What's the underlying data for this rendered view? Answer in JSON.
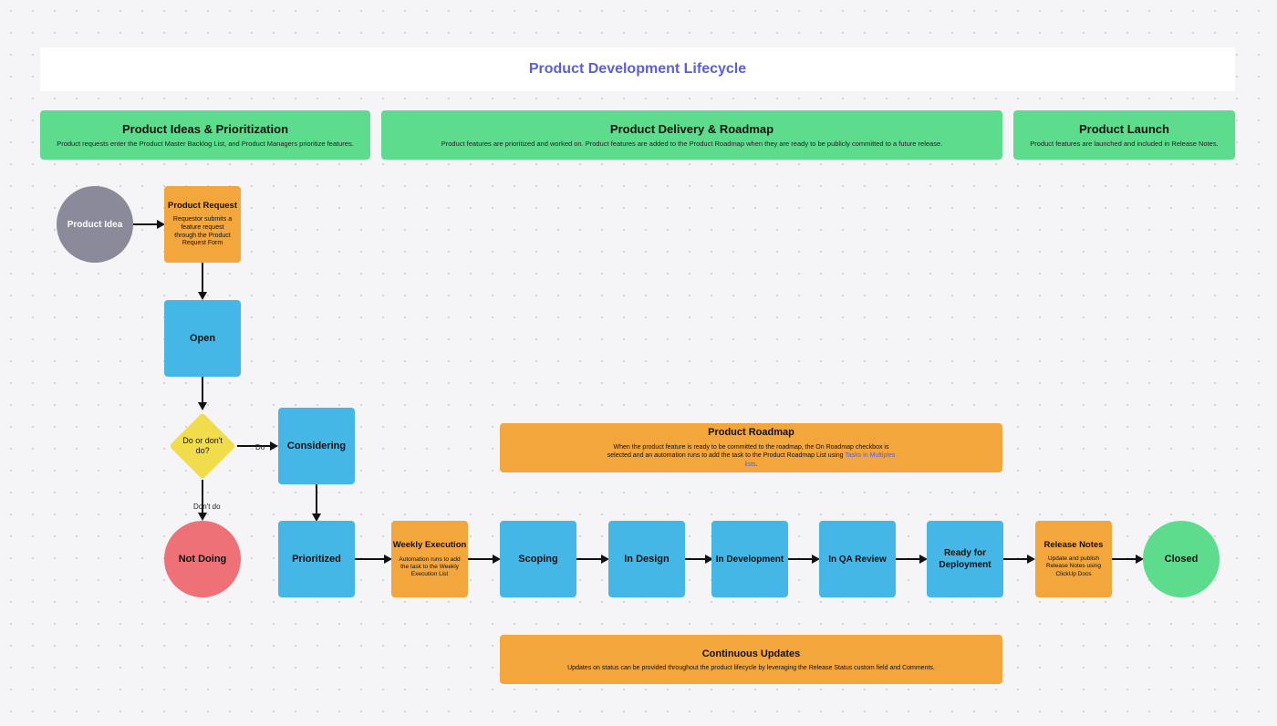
{
  "title": "Product Development Lifecycle",
  "phases": {
    "ideas": {
      "title": "Product Ideas & Prioritization",
      "desc": "Product requests enter the Product Master Backlog List, and Product Managers prioritize features."
    },
    "delivery": {
      "title": "Product Delivery & Roadmap",
      "desc": "Product features are prioritized and worked on. Product features are added to the Product Roadmap when they are ready to be publicly committed to a future release."
    },
    "launch": {
      "title": "Product Launch",
      "desc": "Product features are launched and included in Release Notes."
    }
  },
  "nodes": {
    "idea": "Product Idea",
    "request": {
      "title": "Product Request",
      "desc": "Requestor submits a feature request through the Product Request Form"
    },
    "open": "Open",
    "decision": "Do or don't do?",
    "considering": "Considering",
    "not_doing": "Not Doing",
    "prioritized": "Prioritized",
    "weekly": {
      "title": "Weekly Execution",
      "desc": "Automation runs to add the task to the Weekly Execution List"
    },
    "scoping": "Scoping",
    "in_design": "In Design",
    "in_dev": "In Development",
    "in_qa": "In QA Review",
    "ready_deploy": "Ready for Deployment",
    "release_notes": {
      "title": "Release Notes",
      "desc": "Update and publish Release Notes using ClickUp Docs"
    },
    "closed": "Closed"
  },
  "roadmap": {
    "title": "Product Roadmap",
    "body_pre": "When the product feature is ready to be committed to the roadmap, the On Roadmap checkbox is selected and an automation runs to add the task to the Product Roadmap List using ",
    "link": "Tasks in Multiples lists",
    "body_post": "."
  },
  "continuous": {
    "title": "Continuous Updates",
    "desc": "Updates on status can be provided throughout the product lifecycle by leveraging the Release Status custom field and Comments."
  },
  "labels": {
    "do": "Do",
    "dont": "Don't do"
  }
}
